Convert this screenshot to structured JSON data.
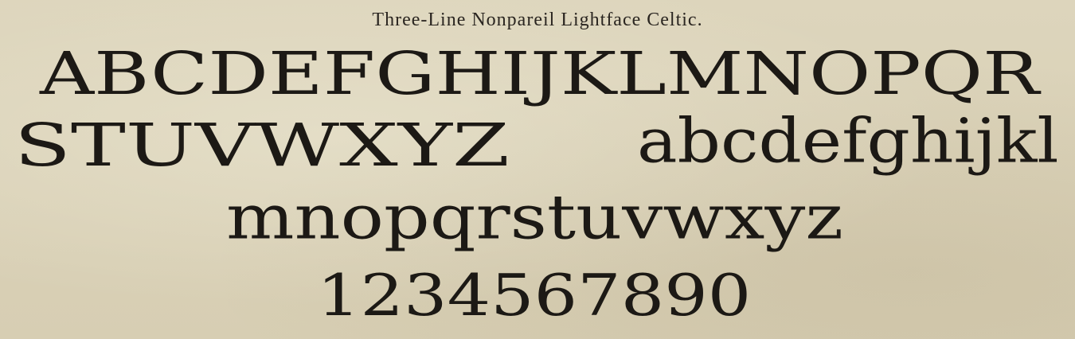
{
  "page": {
    "title": "Three-Line Nonpareil Lightface Celtic.",
    "background_color": "#d9d0b6",
    "ink_color": "#1c1915"
  },
  "specimen": {
    "uppercase_line1": "ABCDEFGHIJKLMNOPQR",
    "uppercase_line2": "STUVWXYZ",
    "lowercase_line1": "abcdefghijkl",
    "lowercase_line2": "mnopqrstuvwxyz",
    "numerals": "1234567890"
  }
}
